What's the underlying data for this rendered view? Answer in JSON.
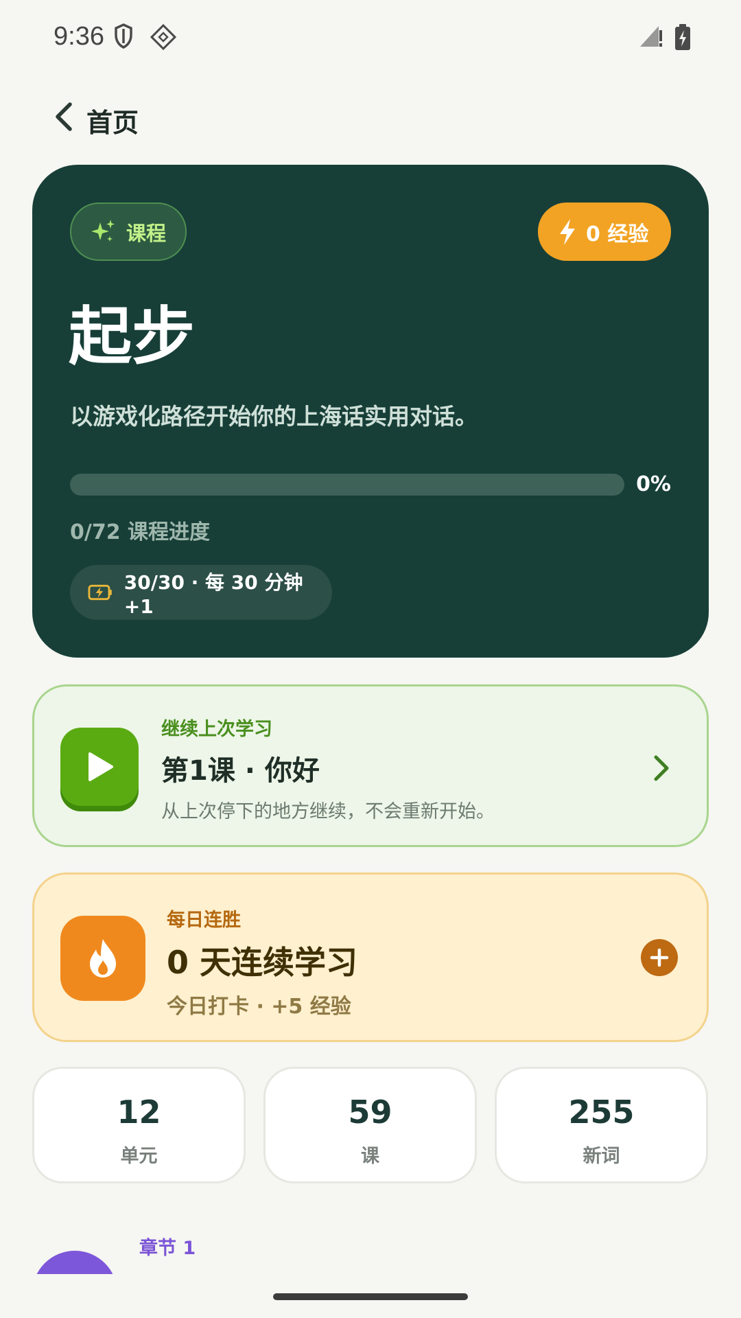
{
  "status_bar": {
    "time": "9:36",
    "icons": [
      "shield-icon",
      "cast-icon",
      "signal-icon",
      "battery-charging-icon"
    ]
  },
  "header": {
    "back_icon": "chevron-left-icon",
    "title": "首页"
  },
  "hero": {
    "course_badge": {
      "icon": "sparkles-icon",
      "label": "课程"
    },
    "xp_badge": {
      "icon": "lightning-icon",
      "label": "0 经验"
    },
    "title": "起步",
    "subtitle": "以游戏化路径开始你的上海话实用对话。",
    "progress": {
      "percent": 0,
      "percent_label": "0%",
      "caption": "0/72 课程进度"
    },
    "energy": {
      "icon": "battery-bolt-icon",
      "label": "30/30 · 每 30 分钟 +1"
    }
  },
  "continue": {
    "icon": "play-icon",
    "kicker": "继续上次学习",
    "title": "第1课 · 你好",
    "description": "从上次停下的地方继续，不会重新开始。"
  },
  "streak": {
    "icon": "flame-icon",
    "kicker": "每日连胜",
    "title": "0 天连续学习",
    "description": "今日打卡 · +5 经验"
  },
  "stats": [
    {
      "value": "12",
      "label": "单元"
    },
    {
      "value": "59",
      "label": "课"
    },
    {
      "value": "255",
      "label": "新词"
    }
  ],
  "chapter": {
    "label": "章节 1"
  },
  "colors": {
    "hero_bg": "#173f38",
    "accent_orange": "#f2a324",
    "accent_green": "#5aab12",
    "streak_orange": "#f0891d",
    "chapter_purple": "#7d57d9",
    "background": "#f6f6f2"
  }
}
